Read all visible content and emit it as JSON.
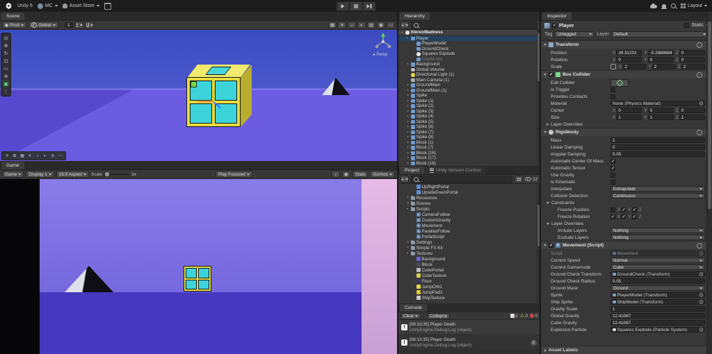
{
  "topbar": {
    "app_title": "Unity 6",
    "account": "MC",
    "asset_store": "Asset Store",
    "layout": "Layout"
  },
  "scene": {
    "tab": "Scene",
    "pivot": "Pivot",
    "global": "Global",
    "grid_size": "1",
    "persp": "Persp",
    "tools": [
      {
        "glyph": "◎",
        "name": "view-tool"
      },
      {
        "glyph": "⊕",
        "name": "move-tool"
      },
      {
        "glyph": "↻",
        "name": "rotate-tool"
      },
      {
        "glyph": "⊡",
        "name": "scale-tool"
      },
      {
        "glyph": "▭",
        "name": "rect-tool"
      },
      {
        "glyph": "⊛",
        "name": "transform-tool"
      },
      {
        "glyph": "▣",
        "name": "custom-tool",
        "state": "on"
      },
      {
        "glyph": "⋮",
        "name": "more-tools"
      }
    ],
    "right_icons": [
      {
        "glyph": "▦",
        "name": "grid-visibility-icon"
      },
      {
        "glyph": "☀",
        "name": "scene-lighting-icon"
      },
      {
        "glyph": "♪",
        "name": "scene-audio-icon"
      },
      {
        "glyph": "◐",
        "name": "scene-effects-icon"
      },
      {
        "glyph": "▥",
        "name": "overlays-icon"
      },
      {
        "glyph": "◉",
        "name": "scene-camera-icon"
      },
      {
        "glyph": "⋯",
        "name": "scene-more-icon"
      }
    ],
    "overlay_icons": [
      {
        "glyph": "≡",
        "name": "overlay-menu-icon"
      },
      {
        "glyph": "⊞",
        "name": "draw-mode-icon"
      },
      {
        "glyph": "▦",
        "name": "shading-mode-icon"
      },
      {
        "glyph": "☀",
        "name": "lighting-toggle-icon"
      },
      {
        "glyph": "♪",
        "name": "audio-toggle-icon"
      },
      {
        "glyph": "◐",
        "name": "effects-toggle-icon"
      },
      {
        "glyph": "◎",
        "name": "camera-preview-icon"
      },
      {
        "glyph": "⋯",
        "name": "overlay-more-icon"
      }
    ]
  },
  "game": {
    "tab": "Game",
    "mode": "Game",
    "display": "Display 1",
    "aspect": "16:9 Aspect",
    "scale_label": "Scale",
    "scale_value": "1x",
    "play_focused": "Play Focused",
    "stats": "Stats",
    "gizmos": "Gizmos",
    "mute_icon": "♪",
    "vsync_icon": "◉"
  },
  "hierarchy": {
    "tab": "Hierarchy",
    "search_placeholder": "",
    "items": [
      {
        "label": "StereoMadness",
        "depth": 0,
        "arrow": "open",
        "icon": "unity",
        "state": "scenehead"
      },
      {
        "label": "Player",
        "depth": 1,
        "arrow": "open",
        "icon": "cube",
        "state": "sel"
      },
      {
        "label": "PlayerModel",
        "depth": 2,
        "arrow": "",
        "icon": "cube"
      },
      {
        "label": "GroundCheck",
        "depth": 2,
        "arrow": "",
        "icon": "cube"
      },
      {
        "label": "Squares Explode",
        "depth": 2,
        "arrow": "",
        "icon": "particle"
      },
      {
        "label": "ShipModel",
        "depth": 2,
        "arrow": "",
        "icon": "cube",
        "text": "dim"
      },
      {
        "label": "Background",
        "depth": 1,
        "arrow": "closed",
        "icon": "cube"
      },
      {
        "label": "Global Volume",
        "depth": 1,
        "arrow": "",
        "icon": "volume"
      },
      {
        "label": "Directional Light (1)",
        "depth": 1,
        "arrow": "",
        "icon": "light"
      },
      {
        "label": "Main Camera (1)",
        "depth": 1,
        "arrow": "",
        "icon": "camera"
      },
      {
        "label": "GroundMain",
        "depth": 1,
        "arrow": "closed",
        "icon": "cube"
      },
      {
        "label": "GroundMain (1)",
        "depth": 1,
        "arrow": "closed",
        "icon": "cube"
      },
      {
        "label": "Spike",
        "depth": 1,
        "arrow": "closed",
        "icon": "cube"
      },
      {
        "label": "Spike (1)",
        "depth": 1,
        "arrow": "closed",
        "icon": "cube"
      },
      {
        "label": "Spike (2)",
        "depth": 1,
        "arrow": "closed",
        "icon": "cube"
      },
      {
        "label": "Spike (3)",
        "depth": 1,
        "arrow": "closed",
        "icon": "cube"
      },
      {
        "label": "Spike (4)",
        "depth": 1,
        "arrow": "closed",
        "icon": "cube"
      },
      {
        "label": "Spike (5)",
        "depth": 1,
        "arrow": "closed",
        "icon": "cube"
      },
      {
        "label": "Spike (6)",
        "depth": 1,
        "arrow": "closed",
        "icon": "cube"
      },
      {
        "label": "Spike (7)",
        "depth": 1,
        "arrow": "closed",
        "icon": "cube"
      },
      {
        "label": "Spike (8)",
        "depth": 1,
        "arrow": "closed",
        "icon": "cube"
      },
      {
        "label": "Block (1)",
        "depth": 1,
        "arrow": "closed",
        "icon": "cube"
      },
      {
        "label": "Block (7)",
        "depth": 1,
        "arrow": "closed",
        "icon": "cube"
      },
      {
        "label": "Block (16)",
        "depth": 1,
        "arrow": "closed",
        "icon": "cube"
      },
      {
        "label": "Block (17)",
        "depth": 1,
        "arrow": "closed",
        "icon": "cube"
      },
      {
        "label": "Block (18)",
        "depth": 1,
        "arrow": "closed",
        "icon": "cube"
      }
    ]
  },
  "project": {
    "tab": "Project",
    "vcs_tab": "Unity Version Control",
    "hidden_count": "22",
    "items": [
      {
        "label": "UpRightPortal",
        "depth": 2,
        "arrow": "",
        "icon": "prefab"
      },
      {
        "label": "UpsideDownPortal",
        "depth": 2,
        "arrow": "",
        "icon": "prefab"
      },
      {
        "label": "Resources",
        "depth": 1,
        "arrow": "closed",
        "icon": "folder"
      },
      {
        "label": "Scenes",
        "depth": 1,
        "arrow": "closed",
        "icon": "folder"
      },
      {
        "label": "Scripts",
        "depth": 1,
        "arrow": "open",
        "icon": "folder"
      },
      {
        "label": "CameraFollow",
        "depth": 2,
        "arrow": "",
        "icon": "script"
      },
      {
        "label": "CustomGravity",
        "depth": 2,
        "arrow": "",
        "icon": "script"
      },
      {
        "label": "Movement",
        "depth": 2,
        "arrow": "",
        "icon": "script"
      },
      {
        "label": "ParallaxFollow",
        "depth": 2,
        "arrow": "",
        "icon": "script"
      },
      {
        "label": "PortalScript",
        "depth": 2,
        "arrow": "",
        "icon": "script"
      },
      {
        "label": "Settings",
        "depth": 1,
        "arrow": "closed",
        "icon": "folder"
      },
      {
        "label": "Simple FX Kit",
        "depth": 1,
        "arrow": "closed",
        "icon": "folder"
      },
      {
        "label": "Textures",
        "depth": 1,
        "arrow": "open",
        "icon": "folder"
      },
      {
        "label": "Background",
        "depth": 2,
        "arrow": "",
        "icon": "tex",
        "tint": "#6a63d8"
      },
      {
        "label": "Block",
        "depth": 2,
        "arrow": "",
        "icon": "tex",
        "tint": "#4a4a55"
      },
      {
        "label": "CubePortal",
        "depth": 2,
        "arrow": "",
        "icon": "tex",
        "tint": "#b9b9c2"
      },
      {
        "label": "CubeTexture",
        "depth": 2,
        "arrow": "",
        "icon": "tex",
        "tint": "#d9cf4b"
      },
      {
        "label": "Floor",
        "depth": 2,
        "arrow": "",
        "icon": "tex",
        "tint": "#3a3564"
      },
      {
        "label": "JumpOrb1",
        "depth": 2,
        "arrow": "",
        "icon": "tex",
        "tint": "#e8d44a"
      },
      {
        "label": "JumpPad1",
        "depth": 2,
        "arrow": "",
        "icon": "tex",
        "tint": "#e0c838"
      },
      {
        "label": "ShipTexture",
        "depth": 2,
        "arrow": "",
        "icon": "tex",
        "tint": "#c9c9c9"
      }
    ]
  },
  "console": {
    "tab": "Console",
    "clear": "Clear",
    "collapse": "Collapse",
    "counts": {
      "logs": "2",
      "warnings": "0",
      "errors": "0"
    },
    "entries": [
      {
        "line1": "[08:13:35] Player Death",
        "line2": "UnityEngine.Debug:Log (object)",
        "count": "",
        "alt": "odd"
      },
      {
        "line1": "[08:13:35] Player Death",
        "line2": "UnityEngine.Debug:Log (object)",
        "count": "2",
        "alt": "even"
      }
    ]
  },
  "inspector": {
    "tab": "Inspector",
    "name": "Player",
    "static_label": "Static",
    "tag_label": "Tag",
    "tag_value": "Untagged",
    "layer_label": "Layer",
    "layer_value": "Default",
    "axis": {
      "x": "X",
      "y": "Y",
      "z": "Z"
    },
    "transform": {
      "title": "Transform",
      "rows": [
        {
          "label": "Position",
          "x": "39.31202",
          "y": "-0.2888684",
          "z": "0",
          "link": ""
        },
        {
          "label": "Rotation",
          "x": "0",
          "y": "0",
          "z": "0",
          "link": ""
        },
        {
          "label": "Scale",
          "x": "2",
          "y": "2",
          "z": "2",
          "link": "on"
        }
      ]
    },
    "box_collider": {
      "title": "Box Collider",
      "enabled": "on",
      "edit_collider_label": "Edit Collider",
      "is_trigger_label": "Is Trigger",
      "is_trigger": "",
      "provides_contacts_label": "Provides Contacts",
      "provides_contacts": "",
      "material_label": "Material",
      "material_value": "None (Physics Material)",
      "center": {
        "label": "Center",
        "x": "0",
        "y": "0",
        "z": "0"
      },
      "size": {
        "label": "Size",
        "x": "1",
        "y": "1",
        "z": "1"
      },
      "layer_overrides_label": "Layer Overrides"
    },
    "rigidbody": {
      "title": "Rigidbody",
      "mass_label": "Mass",
      "mass": "1",
      "linear_damping_label": "Linear Damping",
      "linear_damping": "0",
      "angular_damping_label": "Angular Damping",
      "angular_damping": "0.05",
      "auto_com_label": "Automatic Center Of Mass",
      "auto_com": "on",
      "auto_tensor_label": "Automatic Tensor",
      "auto_tensor": "on",
      "use_gravity_label": "Use Gravity",
      "use_gravity": "",
      "is_kinematic_label": "Is Kinematic",
      "is_kinematic": "",
      "interpolate_label": "Interpolate",
      "interpolate": "Extrapolate",
      "collision_detection_label": "Collision Detection",
      "collision_detection": "Continuous",
      "constraints_label": "Constraints",
      "freeze_position_label": "Freeze Position",
      "fp": {
        "x": "",
        "y": "on",
        "z": "on"
      },
      "freeze_rotation_label": "Freeze Rotation",
      "fr": {
        "x": "on",
        "y": "on",
        "z": "on"
      },
      "layer_overrides_label": "Layer Overrides",
      "include_layers_label": "Include Layers",
      "include_layers": "Nothing",
      "exclude_layers_label": "Exclude Layers",
      "exclude_layers": "Nothing"
    },
    "movement": {
      "title": "Movement (Script)",
      "enabled": "on",
      "script_label": "Script",
      "script_value": "Movement",
      "current_speed_label": "Current Speed",
      "current_speed": "Normal",
      "current_gamemode_label": "Current Gamemode",
      "current_gamemode": "Cube",
      "gct_label": "Ground Check Transform",
      "gct_value": "GroundCheck (Transform)",
      "gcr_label": "Ground Check Radius",
      "gcr": "0.05",
      "mask_label": "Ground Mask",
      "mask": "Ground",
      "sprite_label": "Sprite",
      "sprite_value": "PlayerModel (Transform)",
      "ship_label": "Ship Sprite",
      "ship_value": "ShipModel (Transform)",
      "gs_label": "Gravity Scale",
      "gs": "1",
      "gg_label": "Global Gravity",
      "gg": "12.41067",
      "cg_label": "Cube Gravity",
      "cg": "12.41067",
      "ep_label": "Explosion Particle",
      "ep_value": "Squares Explode (Particle System)"
    },
    "asset_labels": "Asset Labels"
  }
}
